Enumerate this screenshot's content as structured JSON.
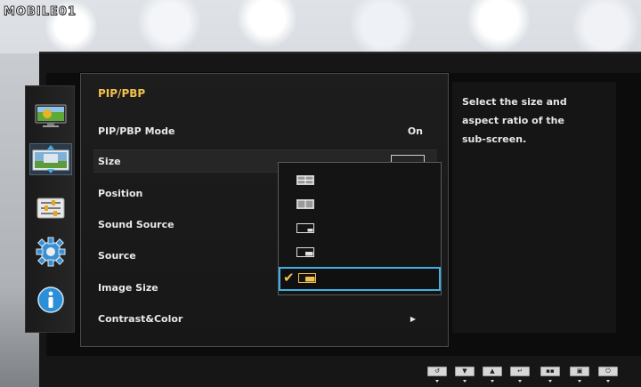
{
  "watermark": {
    "text": "MOBILE01"
  },
  "panel": {
    "title": "PIP/PBP",
    "rows": [
      {
        "label": "PIP/PBP Mode",
        "value": "On"
      },
      {
        "label": "Size",
        "value": ""
      },
      {
        "label": "Position",
        "value": ""
      },
      {
        "label": "Sound Source",
        "value": ""
      },
      {
        "label": "Source",
        "value": ""
      },
      {
        "label": "Image Size",
        "value": ""
      },
      {
        "label": "Contrast&Color",
        "value": "▶"
      }
    ]
  },
  "size_dropdown": {
    "options": [
      {
        "icon": "pbp-side-by-side-icon"
      },
      {
        "icon": "pbp-split-icon"
      },
      {
        "icon": "pip-small-bottom-right-icon"
      },
      {
        "icon": "pip-medium-bottom-right-icon"
      },
      {
        "icon": "pip-large-bottom-right-icon",
        "selected": true
      }
    ],
    "check_glyph": "✔"
  },
  "help": {
    "text": "Select the size and aspect ratio of the sub-screen."
  },
  "side_categories": [
    {
      "icon": "picture-icon"
    },
    {
      "icon": "onscreen-display-icon",
      "selected": true
    },
    {
      "icon": "setup-icon"
    },
    {
      "icon": "system-gear-icon"
    },
    {
      "icon": "information-icon"
    }
  ],
  "controls": [
    {
      "icon": "return-icon",
      "glyph": "↺"
    },
    {
      "icon": "down-arrow-icon",
      "glyph": "▼"
    },
    {
      "icon": "up-arrow-icon",
      "glyph": "▲"
    },
    {
      "icon": "enter-icon",
      "glyph": "↵"
    },
    {
      "icon": "source-icon",
      "glyph": "▪▪"
    },
    {
      "icon": "pip-icon",
      "glyph": "▣"
    },
    {
      "icon": "power-icon",
      "glyph": "⏻"
    }
  ],
  "colors": {
    "title_accent": "#f2c14e",
    "selection_border": "#3fb1e6",
    "checkmark": "#f2c14e"
  }
}
